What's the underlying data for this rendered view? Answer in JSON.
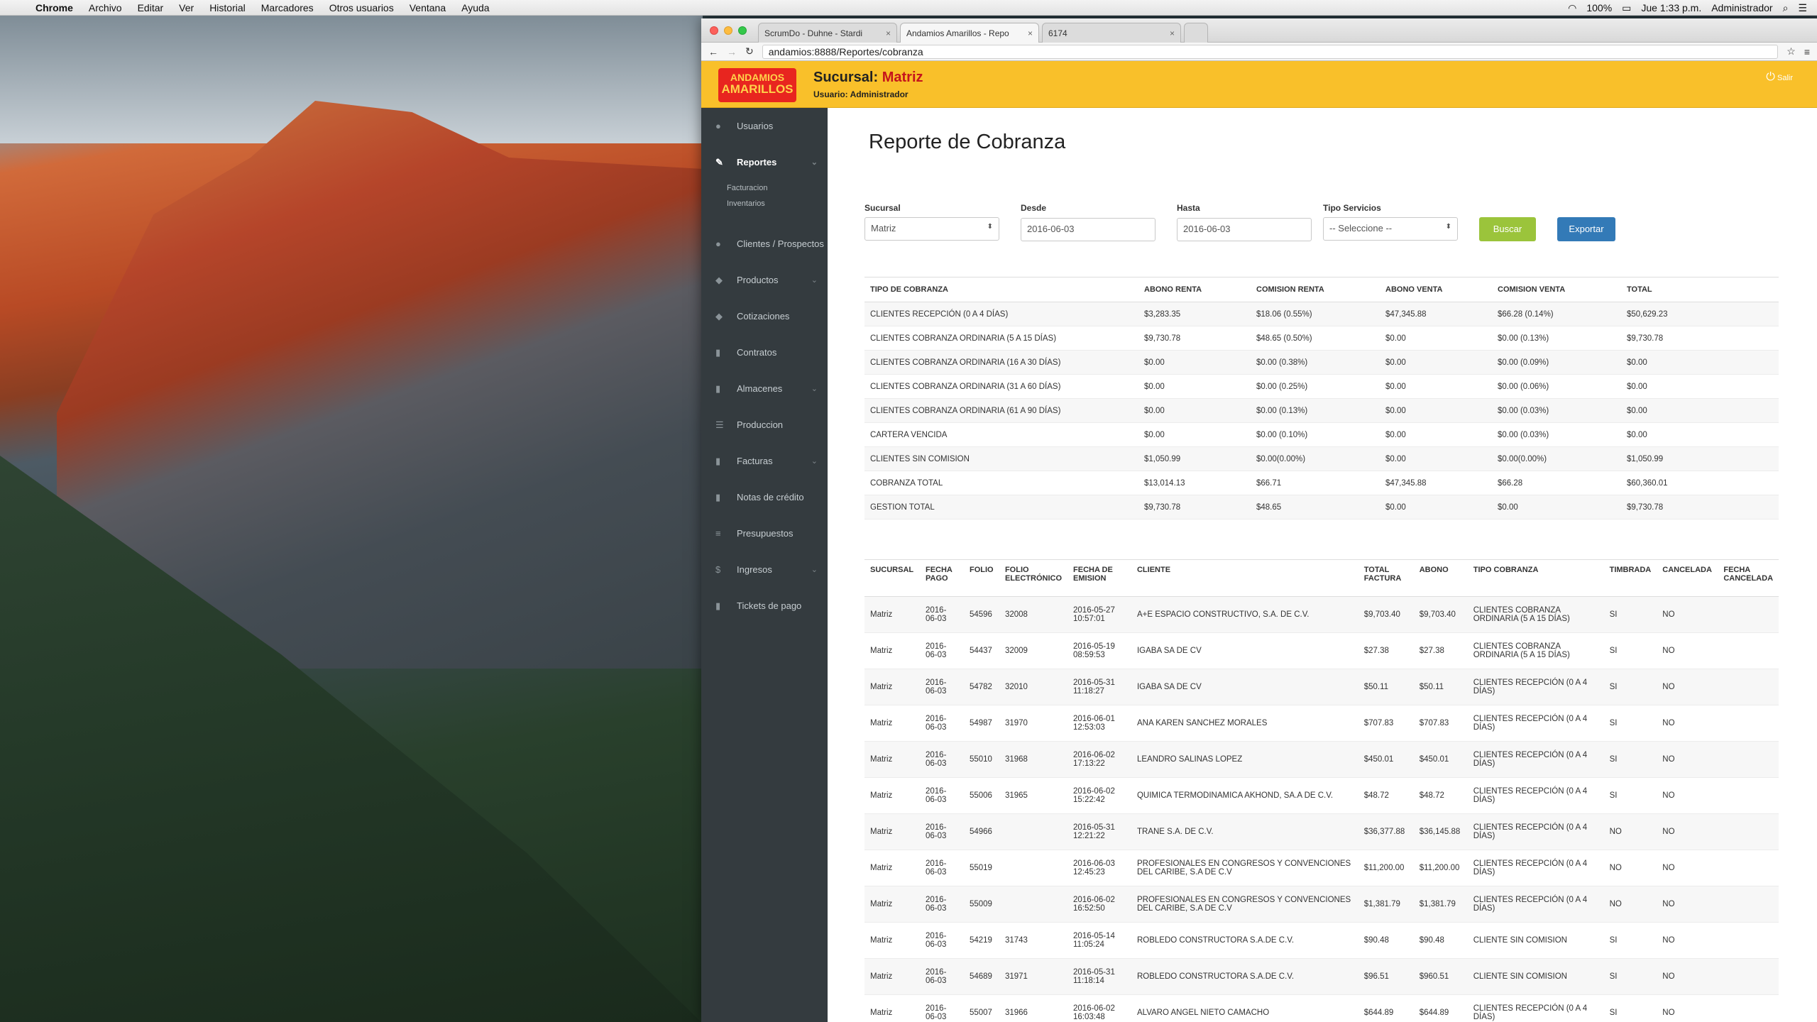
{
  "menubar": {
    "app": "Chrome",
    "items": [
      "Archivo",
      "Editar",
      "Ver",
      "Historial",
      "Marcadores",
      "Otros usuarios",
      "Ventana",
      "Ayuda"
    ],
    "battery": "100%",
    "clock": "Jue 1:33 p.m.",
    "user": "Administrador"
  },
  "browser": {
    "tabs": [
      {
        "label": "ScrumDo - Duhne - Stardi"
      },
      {
        "label": "Andamios Amarillos - Repo"
      },
      {
        "label": "6174"
      }
    ],
    "url": "andamios:8888/Reportes/cobranza"
  },
  "header": {
    "logo_line1": "ANDAMIOS",
    "logo_line2": "AMARILLOS",
    "branch_label": "Sucursal:",
    "branch_value": "Matriz",
    "user_label": "Usuario: Administrador",
    "logout": "Salir"
  },
  "sidebar": {
    "items": [
      {
        "label": "Usuarios",
        "icon": "user-icon"
      },
      {
        "label": "Reportes",
        "icon": "edit-icon"
      },
      {
        "label": "Clientes / Prospectos",
        "icon": "users-icon"
      },
      {
        "label": "Productos",
        "icon": "tag-icon"
      },
      {
        "label": "Cotizaciones",
        "icon": "tag-icon"
      },
      {
        "label": "Contratos",
        "icon": "file-icon"
      },
      {
        "label": "Almacenes",
        "icon": "file-icon"
      },
      {
        "label": "Produccion",
        "icon": "list-icon"
      },
      {
        "label": "Facturas",
        "icon": "file-icon"
      },
      {
        "label": "Notas de crédito",
        "icon": "file-icon"
      },
      {
        "label": "Presupuestos",
        "icon": "menu-icon"
      },
      {
        "label": "Ingresos",
        "icon": "dollar-icon"
      },
      {
        "label": "Tickets de pago",
        "icon": "file-icon"
      }
    ],
    "sub": [
      "Facturacion",
      "Inventarios"
    ]
  },
  "page": {
    "title": "Reporte de Cobranza",
    "filters": {
      "sucursal_label": "Sucursal",
      "sucursal_value": "Matriz",
      "desde_label": "Desde",
      "desde_value": "2016-06-03",
      "hasta_label": "Hasta",
      "hasta_value": "2016-06-03",
      "tipo_label": "Tipo Servicios",
      "tipo_value": "-- Seleccione --",
      "buscar": "Buscar",
      "exportar": "Exportar"
    }
  },
  "summary": {
    "headers": [
      "TIPO DE COBRANZA",
      "ABONO RENTA",
      "COMISION RENTA",
      "ABONO VENTA",
      "COMISION VENTA",
      "TOTAL"
    ],
    "rows": [
      [
        "CLIENTES RECEPCIÓN (0 A 4 DÍAS)",
        "$3,283.35",
        "$18.06 (0.55%)",
        "$47,345.88",
        "$66.28 (0.14%)",
        "$50,629.23"
      ],
      [
        "CLIENTES COBRANZA ORDINARIA (5 A 15 DÍAS)",
        "$9,730.78",
        "$48.65 (0.50%)",
        "$0.00",
        "$0.00 (0.13%)",
        "$9,730.78"
      ],
      [
        "CLIENTES COBRANZA ORDINARIA (16 A 30 DÍAS)",
        "$0.00",
        "$0.00 (0.38%)",
        "$0.00",
        "$0.00 (0.09%)",
        "$0.00"
      ],
      [
        "CLIENTES COBRANZA ORDINARIA (31 A 60 DÍAS)",
        "$0.00",
        "$0.00 (0.25%)",
        "$0.00",
        "$0.00 (0.06%)",
        "$0.00"
      ],
      [
        "CLIENTES COBRANZA ORDINARIA (61 A 90 DÍAS)",
        "$0.00",
        "$0.00 (0.13%)",
        "$0.00",
        "$0.00 (0.03%)",
        "$0.00"
      ],
      [
        "CARTERA VENCIDA",
        "$0.00",
        "$0.00 (0.10%)",
        "$0.00",
        "$0.00 (0.03%)",
        "$0.00"
      ],
      [
        "CLIENTES SIN COMISION",
        "$1,050.99",
        "$0.00(0.00%)",
        "$0.00",
        "$0.00(0.00%)",
        "$1,050.99"
      ],
      [
        "COBRANZA TOTAL",
        "$13,014.13",
        "$66.71",
        "$47,345.88",
        "$66.28",
        "$60,360.01"
      ],
      [
        "GESTION TOTAL",
        "$9,730.78",
        "$48.65",
        "$0.00",
        "$0.00",
        "$9,730.78"
      ]
    ]
  },
  "detail": {
    "headers": [
      "SUCURSAL",
      "FECHA PAGO",
      "FOLIO",
      "FOLIO ELECTRÓNICO",
      "FECHA DE EMISION",
      "CLIENTE",
      "TOTAL FACTURA",
      "ABONO",
      "TIPO COBRANZA",
      "TIMBRADA",
      "CANCELADA",
      "FECHA CANCELADA"
    ],
    "rows": [
      [
        "Matriz",
        "2016-06-03",
        "54596",
        "32008",
        "2016-05-27 10:57:01",
        "A+E ESPACIO CONSTRUCTIVO, S.A. DE C.V.",
        "$9,703.40",
        "$9,703.40",
        "CLIENTES COBRANZA ORDINARIA (5 A 15 DÍAS)",
        "SI",
        "NO",
        ""
      ],
      [
        "Matriz",
        "2016-06-03",
        "54437",
        "32009",
        "2016-05-19 08:59:53",
        "IGABA SA DE CV",
        "$27.38",
        "$27.38",
        "CLIENTES COBRANZA ORDINARIA (5 A 15 DÍAS)",
        "SI",
        "NO",
        ""
      ],
      [
        "Matriz",
        "2016-06-03",
        "54782",
        "32010",
        "2016-05-31 11:18:27",
        "IGABA SA DE CV",
        "$50.11",
        "$50.11",
        "CLIENTES RECEPCIÓN (0 A 4 DÍAS)",
        "SI",
        "NO",
        ""
      ],
      [
        "Matriz",
        "2016-06-03",
        "54987",
        "31970",
        "2016-06-01 12:53:03",
        "ANA KAREN SANCHEZ MORALES",
        "$707.83",
        "$707.83",
        "CLIENTES RECEPCIÓN (0 A 4 DÍAS)",
        "SI",
        "NO",
        ""
      ],
      [
        "Matriz",
        "2016-06-03",
        "55010",
        "31968",
        "2016-06-02 17:13:22",
        "LEANDRO SALINAS LOPEZ",
        "$450.01",
        "$450.01",
        "CLIENTES RECEPCIÓN (0 A 4 DÍAS)",
        "SI",
        "NO",
        ""
      ],
      [
        "Matriz",
        "2016-06-03",
        "55006",
        "31965",
        "2016-06-02 15:22:42",
        "QUIMICA TERMODINAMICA AKHOND, SA.A DE C.V.",
        "$48.72",
        "$48.72",
        "CLIENTES RECEPCIÓN (0 A 4 DÍAS)",
        "SI",
        "NO",
        ""
      ],
      [
        "Matriz",
        "2016-06-03",
        "54966",
        "",
        "2016-05-31 12:21:22",
        "TRANE S.A. DE C.V.",
        "$36,377.88",
        "$36,145.88",
        "CLIENTES RECEPCIÓN (0 A 4 DÍAS)",
        "NO",
        "NO",
        ""
      ],
      [
        "Matriz",
        "2016-06-03",
        "55019",
        "",
        "2016-06-03 12:45:23",
        "PROFESIONALES EN CONGRESOS Y CONVENCIONES DEL CARIBE, S.A DE C.V",
        "$11,200.00",
        "$11,200.00",
        "CLIENTES RECEPCIÓN (0 A 4 DÍAS)",
        "NO",
        "NO",
        ""
      ],
      [
        "Matriz",
        "2016-06-03",
        "55009",
        "",
        "2016-06-02 16:52:50",
        "PROFESIONALES EN CONGRESOS Y CONVENCIONES DEL CARIBE, S.A DE C.V",
        "$1,381.79",
        "$1,381.79",
        "CLIENTES RECEPCIÓN (0 A 4 DÍAS)",
        "NO",
        "NO",
        ""
      ],
      [
        "Matriz",
        "2016-06-03",
        "54219",
        "31743",
        "2016-05-14 11:05:24",
        "ROBLEDO CONSTRUCTORA S.A.DE C.V.",
        "$90.48",
        "$90.48",
        "CLIENTE SIN COMISION",
        "SI",
        "NO",
        ""
      ],
      [
        "Matriz",
        "2016-06-03",
        "54689",
        "31971",
        "2016-05-31 11:18:14",
        "ROBLEDO CONSTRUCTORA S.A.DE C.V.",
        "$96.51",
        "$960.51",
        "CLIENTE SIN COMISION",
        "SI",
        "NO",
        ""
      ],
      [
        "Matriz",
        "2016-06-03",
        "55007",
        "31966",
        "2016-06-02 16:03:48",
        "ALVARO ANGEL NIETO CAMACHO",
        "$644.89",
        "$644.89",
        "CLIENTES RECEPCIÓN (0 A 4 DÍAS)",
        "SI",
        "NO",
        ""
      ]
    ]
  }
}
